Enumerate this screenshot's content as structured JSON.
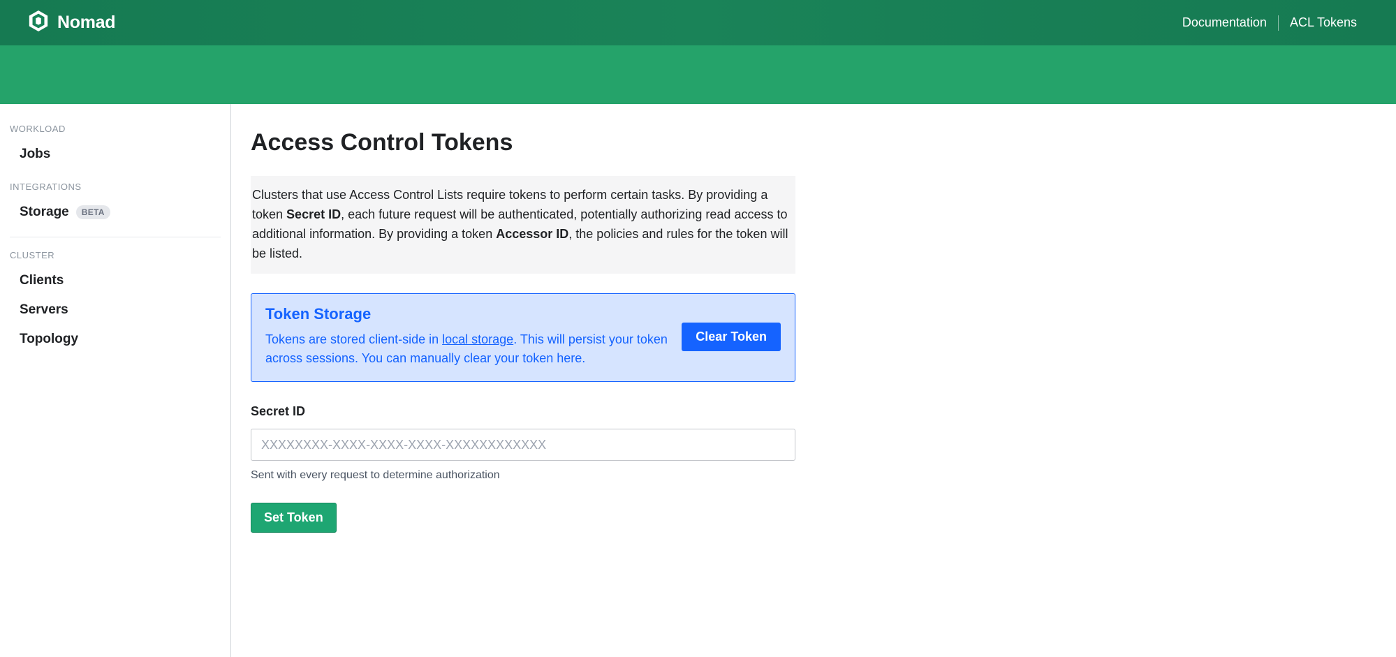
{
  "brand": {
    "name": "Nomad"
  },
  "topnav": {
    "documentation": "Documentation",
    "acl_tokens": "ACL Tokens"
  },
  "sidebar": {
    "sections": {
      "workload": {
        "label": "WORKLOAD",
        "jobs": "Jobs"
      },
      "integrations": {
        "label": "INTEGRATIONS",
        "storage": "Storage",
        "storage_badge": "BETA"
      },
      "cluster": {
        "label": "CLUSTER",
        "clients": "Clients",
        "servers": "Servers",
        "topology": "Topology"
      }
    }
  },
  "page": {
    "title": "Access Control Tokens",
    "notice": {
      "pre": "Clusters that use Access Control Lists require tokens to perform certain tasks. By providing a token ",
      "secret_id": "Secret ID",
      "mid": ", each future request will be authenticated, potentially authorizing read access to additional information. By providing a token ",
      "accessor_id": "Accessor ID",
      "post": ", the policies and rules for the token will be listed."
    },
    "callout": {
      "title": "Token Storage",
      "body_pre": "Tokens are stored client-side in ",
      "body_link": "local storage",
      "body_post": ". This will persist your token across sessions. You can manually clear your token here.",
      "clear_button": "Clear Token"
    },
    "form": {
      "secret_id_label": "Secret ID",
      "secret_id_placeholder": "XXXXXXXX-XXXX-XXXX-XXXX-XXXXXXXXXXXX",
      "secret_id_help": "Sent with every request to determine authorization",
      "submit": "Set Token"
    }
  }
}
